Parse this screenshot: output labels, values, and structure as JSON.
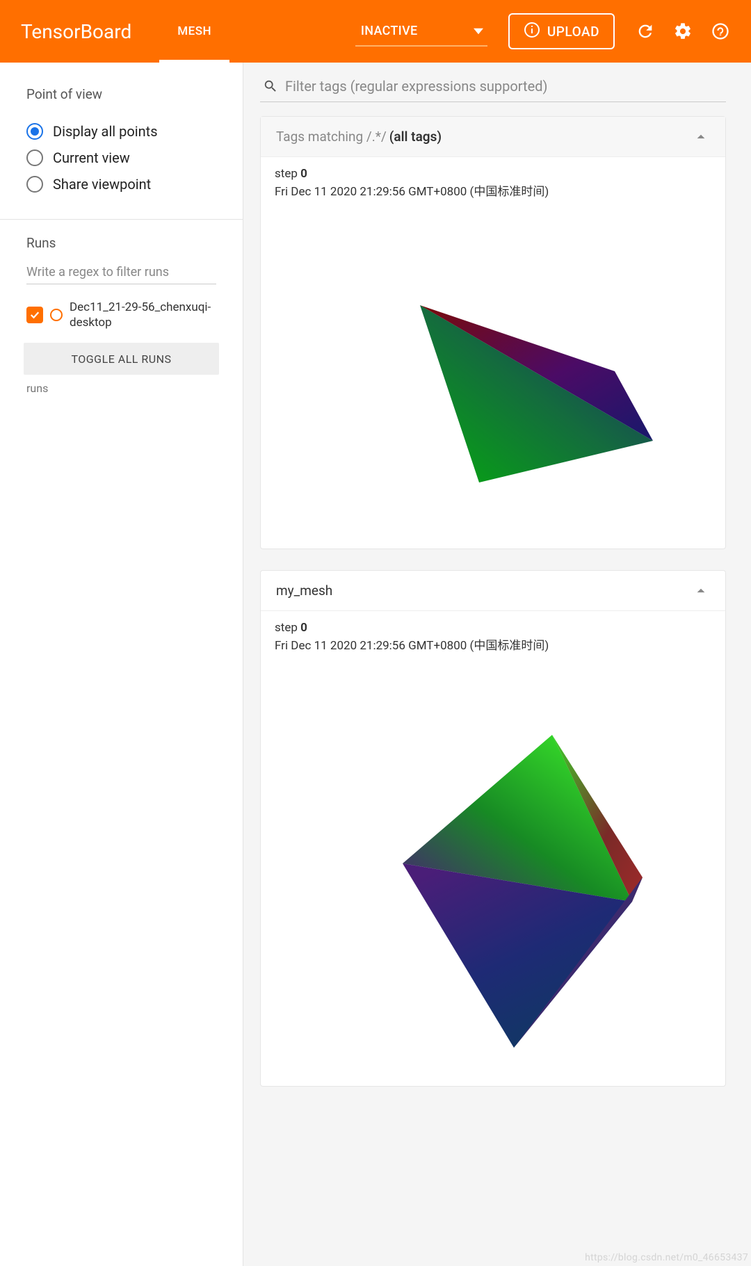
{
  "header": {
    "app_title": "TensorBoard",
    "tab_mesh": "MESH",
    "inactive_label": "INACTIVE",
    "upload_label": "UPLOAD"
  },
  "sidebar": {
    "pov_heading": "Point of view",
    "pov_options": [
      {
        "label": "Display all points",
        "selected": true
      },
      {
        "label": "Current view",
        "selected": false
      },
      {
        "label": "Share viewpoint",
        "selected": false
      }
    ],
    "runs_heading": "Runs",
    "runs_filter_placeholder": "Write a regex to filter runs",
    "run_name": "Dec11_21-29-56_chenxuqi-desktop",
    "toggle_all_label": "TOGGLE ALL RUNS",
    "runs_footer": "runs"
  },
  "main": {
    "filter_placeholder": "Filter tags (regular expressions supported)"
  },
  "cards": {
    "c0": {
      "title_prefix": "Tags matching /.*/",
      "title_bold": "(all tags)",
      "step_label": "step ",
      "step_value": "0",
      "timestamp": "Fri Dec 11 2020 21:29:56 GMT+0800 (中国标准时间)"
    },
    "c1": {
      "title": "my_mesh",
      "step_label": "step ",
      "step_value": "0",
      "timestamp": "Fri Dec 11 2020 21:29:56 GMT+0800 (中国标准时间)"
    }
  },
  "watermark": "https://blog.csdn.net/m0_46653437"
}
